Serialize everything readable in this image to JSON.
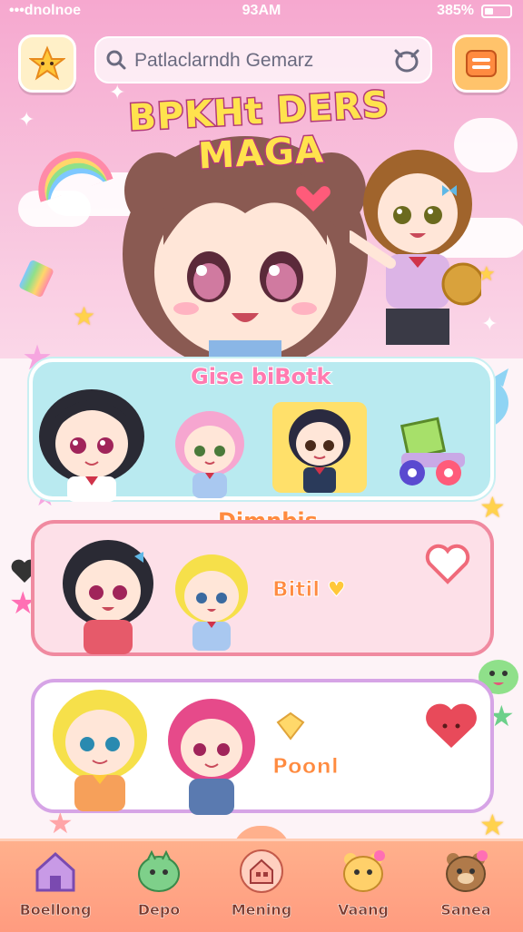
{
  "status": {
    "carrier": "•••dnolnoe",
    "time": "93AM",
    "battery": "385%"
  },
  "header": {
    "search_placeholder": "Patlaclarndh Gemarz"
  },
  "hero": {
    "title": "BPKHt DERS MAGA"
  },
  "sections": [
    {
      "title": "Gise biBotk"
    },
    {
      "title": "Dimnbis",
      "label": "Bitil"
    },
    {
      "label": "Poonl"
    }
  ],
  "nav": {
    "items": [
      {
        "label": "Boellong",
        "icon": "home-icon"
      },
      {
        "label": "Depo",
        "icon": "dragon-icon"
      },
      {
        "label": "Mening",
        "icon": "house-icon"
      },
      {
        "label": "Vaang",
        "icon": "bear-icon"
      },
      {
        "label": "Sanea",
        "icon": "bear-flower-icon"
      }
    ]
  },
  "colors": {
    "hero_bg": "#f6a8cf",
    "nav_bg": "#ffa385",
    "panel_blue": "#b9eaf0",
    "panel_pink": "#fde0e8",
    "accent_orange": "#ff8b40"
  }
}
